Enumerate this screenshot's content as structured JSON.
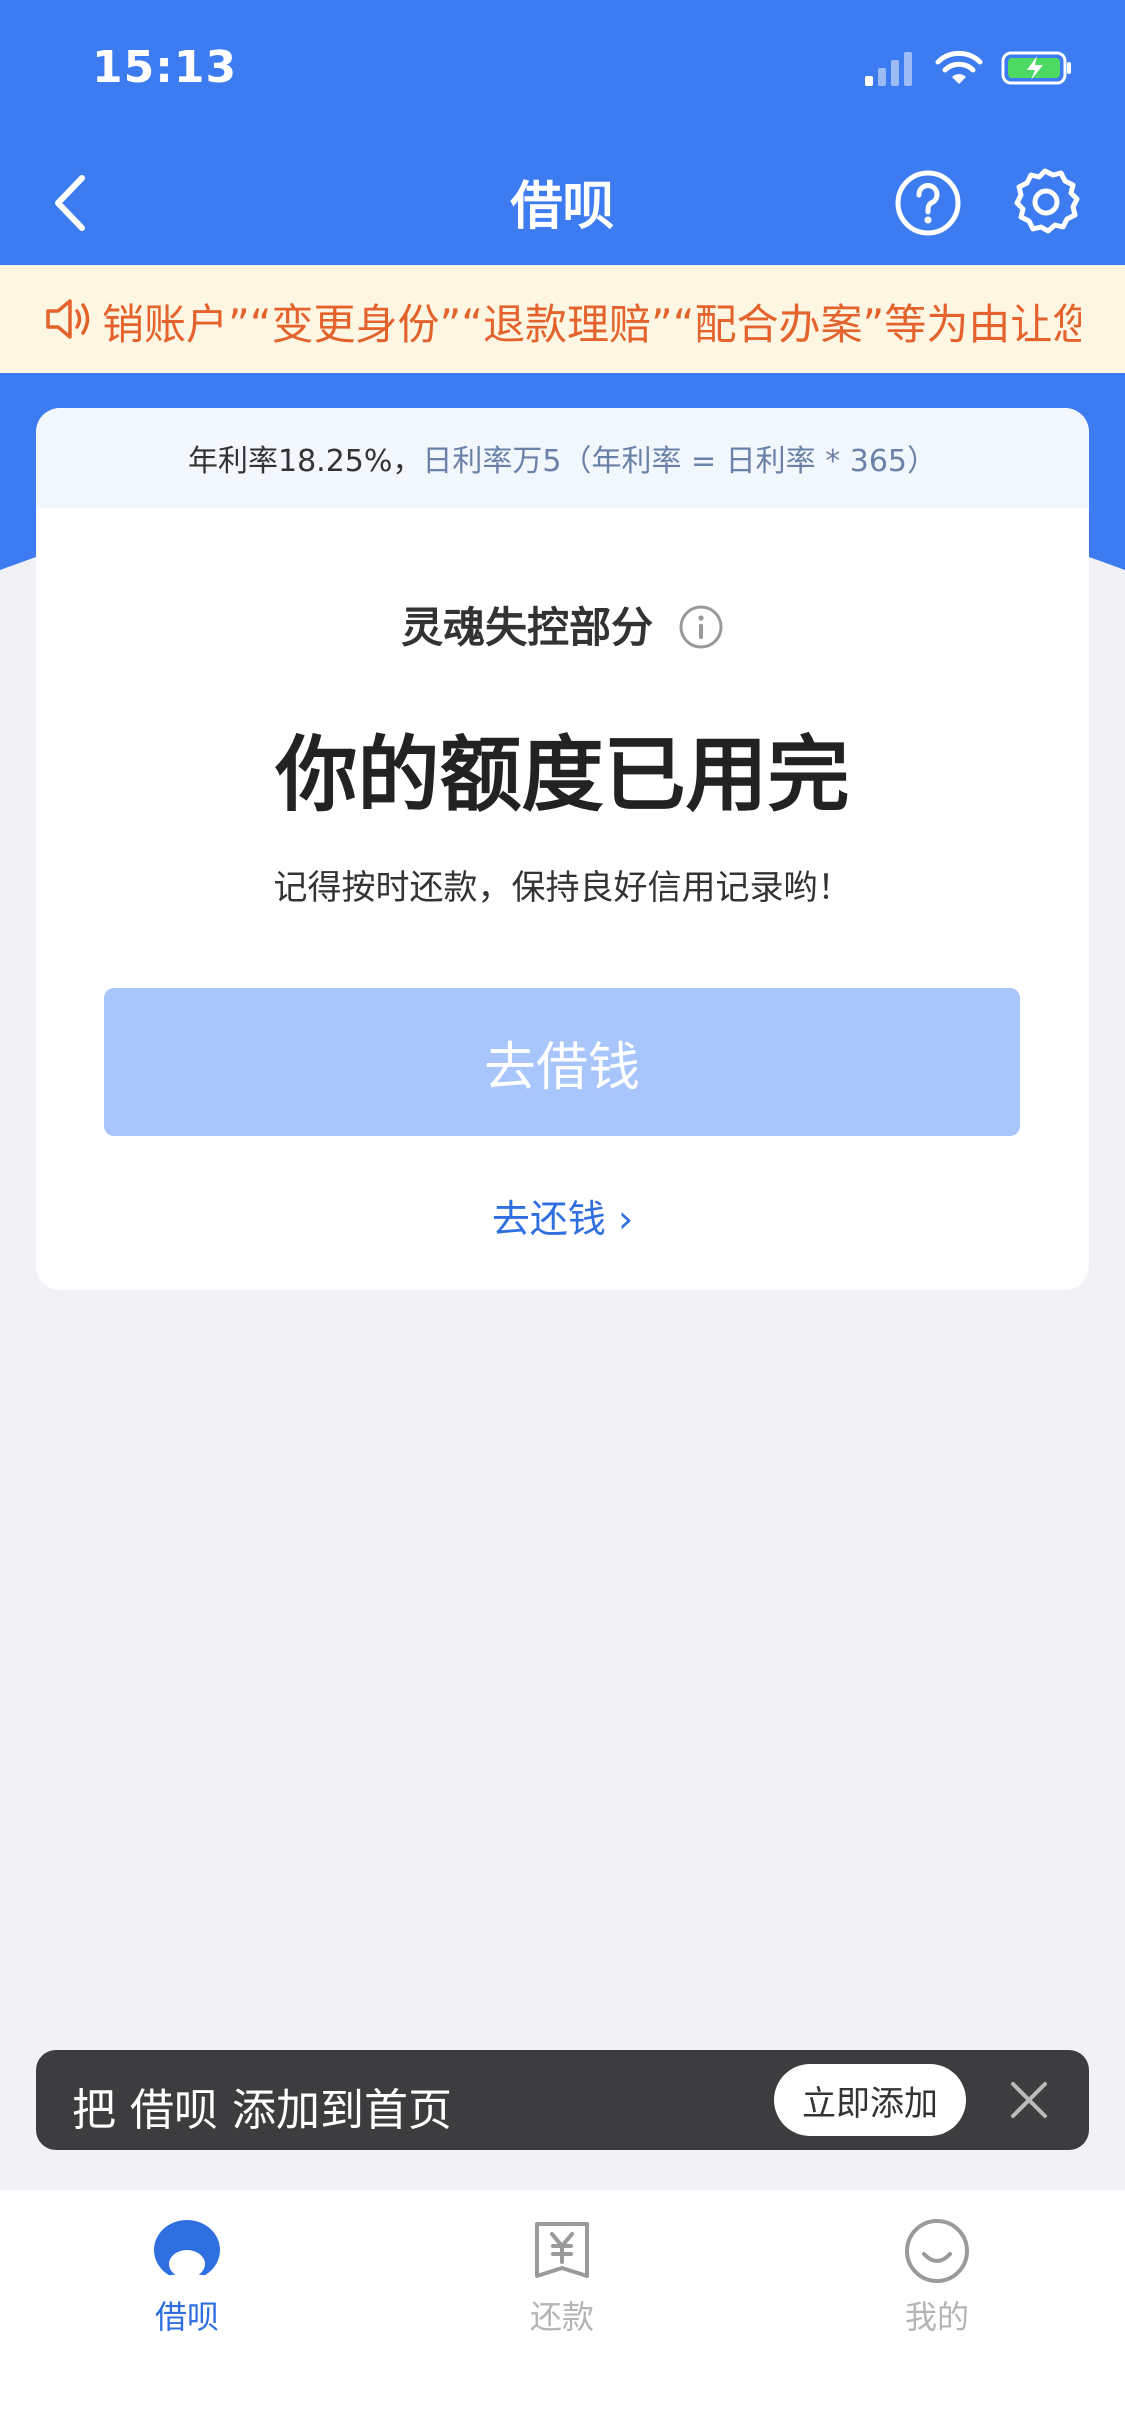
{
  "status_bar": {
    "time": "15:13"
  },
  "nav": {
    "title": "借呗"
  },
  "notice": {
    "text": "销账户”“变更身份”“退款理赔”“配合办案”等为由让您"
  },
  "card": {
    "rate_main": "年利率18.25%，",
    "rate_sub": "日利率万5（年利率 = 日利率 * 365）",
    "quota_label": "灵魂失控部分",
    "headline": "你的额度已用完",
    "tip": "记得按时还款，保持良好信用记录哟！",
    "borrow_button": "去借钱",
    "repay_link": "去还钱 ›"
  },
  "toast": {
    "text": "把 借呗 添加到首页",
    "button": "立即添加"
  },
  "tabs": [
    {
      "label": "借呗",
      "icon": "jiebei-icon",
      "active": true
    },
    {
      "label": "还款",
      "icon": "repay-icon",
      "active": false
    },
    {
      "label": "我的",
      "icon": "smile-icon",
      "active": false
    }
  ],
  "colors": {
    "brand": "#3c7bf0",
    "notice_text": "#e4632c",
    "button_disabled": "#a8c6fb",
    "link": "#2f6fe0"
  }
}
